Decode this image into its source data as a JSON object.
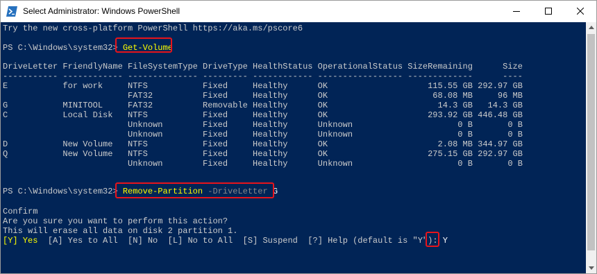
{
  "window": {
    "title": "Select Administrator: Windows PowerShell",
    "icon": "powershell-icon",
    "controls": [
      "minimize-icon",
      "maximize-icon",
      "close-icon"
    ]
  },
  "console": {
    "intro": "Try the new cross-platform PowerShell https://aka.ms/pscore6",
    "prompt": "PS C:\\Windows\\system32> ",
    "command1": "Get-Volume",
    "table_header": "DriveLetter FriendlyName FileSystemType DriveType HealthStatus OperationalStatus SizeRemaining      Size",
    "table_separator": "----------- ------------ -------------- --------- ------------ ----------------- -------------      ----",
    "rows": [
      "E           for work     NTFS           Fixed     Healthy      OK                    115.55 GB 292.97 GB",
      "                         FAT32          Fixed     Healthy      OK                     68.08 MB     96 MB",
      "G           MINITOOL     FAT32          Removable Healthy      OK                      14.3 GB   14.3 GB",
      "C           Local Disk   NTFS           Fixed     Healthy      OK                    293.92 GB 446.48 GB",
      "                         Unknown        Fixed     Healthy      Unknown                     0 B       0 B",
      "                         Unknown        Fixed     Healthy      Unknown                     0 B       0 B",
      "D           New Volume   NTFS           Fixed     Healthy      OK                      2.08 MB 344.97 GB",
      "Q           New Volume   NTFS           Fixed     Healthy      OK                    275.15 GB 292.97 GB",
      "                         Unknown        Fixed     Healthy      Unknown                     0 B       0 B"
    ],
    "command2": "Remove-Partition",
    "command2_param": "-DriveLetter",
    "command2_value": "G",
    "confirm_title": "Confirm",
    "confirm_question": "Are you sure you want to perform this action?",
    "confirm_detail": "This will erase all data on disk 2 partition 1.",
    "choice_default": "[Y] Yes",
    "choice_rest": "  [A] Yes to All  [N] No  [L] No to All  [S] Suspend  [?] Help (default is \"Y\"): ",
    "answer": "Y"
  },
  "colors": {
    "background": "#012456",
    "text": "#cccccc",
    "command": "#ffff00",
    "parameter": "#8a8a8a",
    "highlight_box": "#e8141b"
  }
}
